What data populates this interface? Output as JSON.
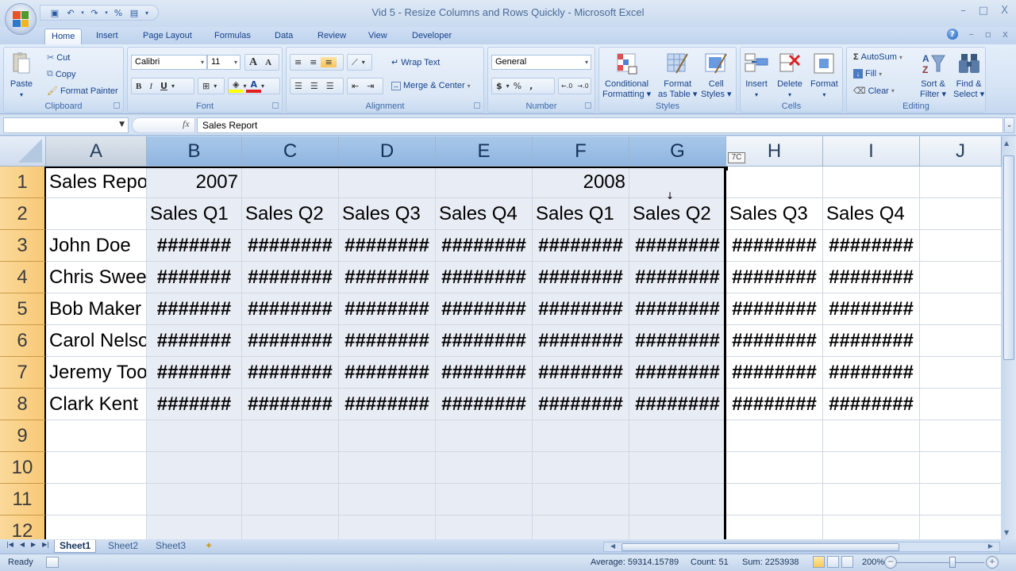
{
  "window": {
    "title": "Vid 5 - Resize Columns and Rows Quickly - Microsoft Excel",
    "controls": {
      "minimize": "–",
      "maximize": "□",
      "close": "X"
    }
  },
  "quick_access": [
    {
      "name": "save",
      "glyph": "💾"
    },
    {
      "name": "undo",
      "glyph": "↶"
    },
    {
      "name": "redo",
      "glyph": "↷"
    },
    {
      "name": "format-cells",
      "glyph": "%"
    },
    {
      "name": "form",
      "glyph": "▤"
    },
    {
      "name": "customize",
      "glyph": "▾"
    }
  ],
  "tabs": [
    "Home",
    "Insert",
    "Page Layout",
    "Formulas",
    "Data",
    "Review",
    "View",
    "Developer"
  ],
  "active_tab": "Home",
  "ribbon": {
    "clipboard": {
      "label": "Clipboard",
      "paste": "Paste",
      "cut": "Cut",
      "copy": "Copy",
      "format_painter": "Format Painter"
    },
    "font": {
      "label": "Font",
      "font_name": "Calibri",
      "font_size": "11",
      "grow": "A",
      "shrink": "A",
      "bold": "B",
      "italic": "I",
      "underline": "U",
      "fill_color": "#ffff00",
      "font_color": "#e02020"
    },
    "alignment": {
      "label": "Alignment",
      "wrap_text": "Wrap Text",
      "merge_center": "Merge & Center"
    },
    "number": {
      "label": "Number",
      "format": "General",
      "currency": "$",
      "percent": "%",
      "comma": ",",
      "inc_decimal": "←.0 .00",
      "dec_decimal": ".00 →.0"
    },
    "styles": {
      "label": "Styles",
      "conditional_formatting": [
        "Conditional",
        "Formatting ▾"
      ],
      "format_as_table": [
        "Format",
        "as Table ▾"
      ],
      "cell_styles": [
        "Cell",
        "Styles ▾"
      ]
    },
    "cells": {
      "label": "Cells",
      "insert": "Insert",
      "delete": "Delete",
      "format": "Format"
    },
    "editing": {
      "label": "Editing",
      "autosum": "AutoSum",
      "fill": "Fill",
      "clear": "Clear",
      "sort_filter": [
        "Sort &",
        "Filter ▾"
      ],
      "find_select": [
        "Find &",
        "Select ▾"
      ]
    }
  },
  "formula_bar": {
    "name_box": "",
    "fx": "fx",
    "content": "Sales Report"
  },
  "columns": [
    "A",
    "B",
    "C",
    "D",
    "E",
    "F",
    "G",
    "H",
    "I",
    "J"
  ],
  "selected_columns": [
    "B",
    "C",
    "D",
    "E",
    "F",
    "G"
  ],
  "rows": [
    "1",
    "2",
    "3",
    "4",
    "5",
    "6",
    "7",
    "8",
    "9",
    "10",
    "11",
    "12"
  ],
  "cells": {
    "A1": "Sales Repo",
    "B1": "2007",
    "F1": "2008",
    "B2": "Sales Q1",
    "C2": "Sales Q2",
    "D2": "Sales Q3",
    "E2": "Sales Q4",
    "F2": "Sales Q1",
    "G2": "Sales Q2",
    "H2": "Sales Q3",
    "I2": "Sales Q4",
    "A3": "John Doe",
    "A4": "Chris Swee",
    "A5": "Bob Maker",
    "A6": "Carol Nelso",
    "A7": "Jeremy Too",
    "A8": "Clark Kent",
    "hash_short": "#######",
    "hash_long": "########"
  },
  "resize_tooltip": "7C",
  "sheets": [
    "Sheet1",
    "Sheet2",
    "Sheet3"
  ],
  "active_sheet": "Sheet1",
  "status": {
    "mode": "Ready",
    "average": "Average: 59314.15789",
    "count": "Count: 51",
    "sum": "Sum: 2253938",
    "zoom": "200%",
    "zoom_fraction": 0.64
  }
}
